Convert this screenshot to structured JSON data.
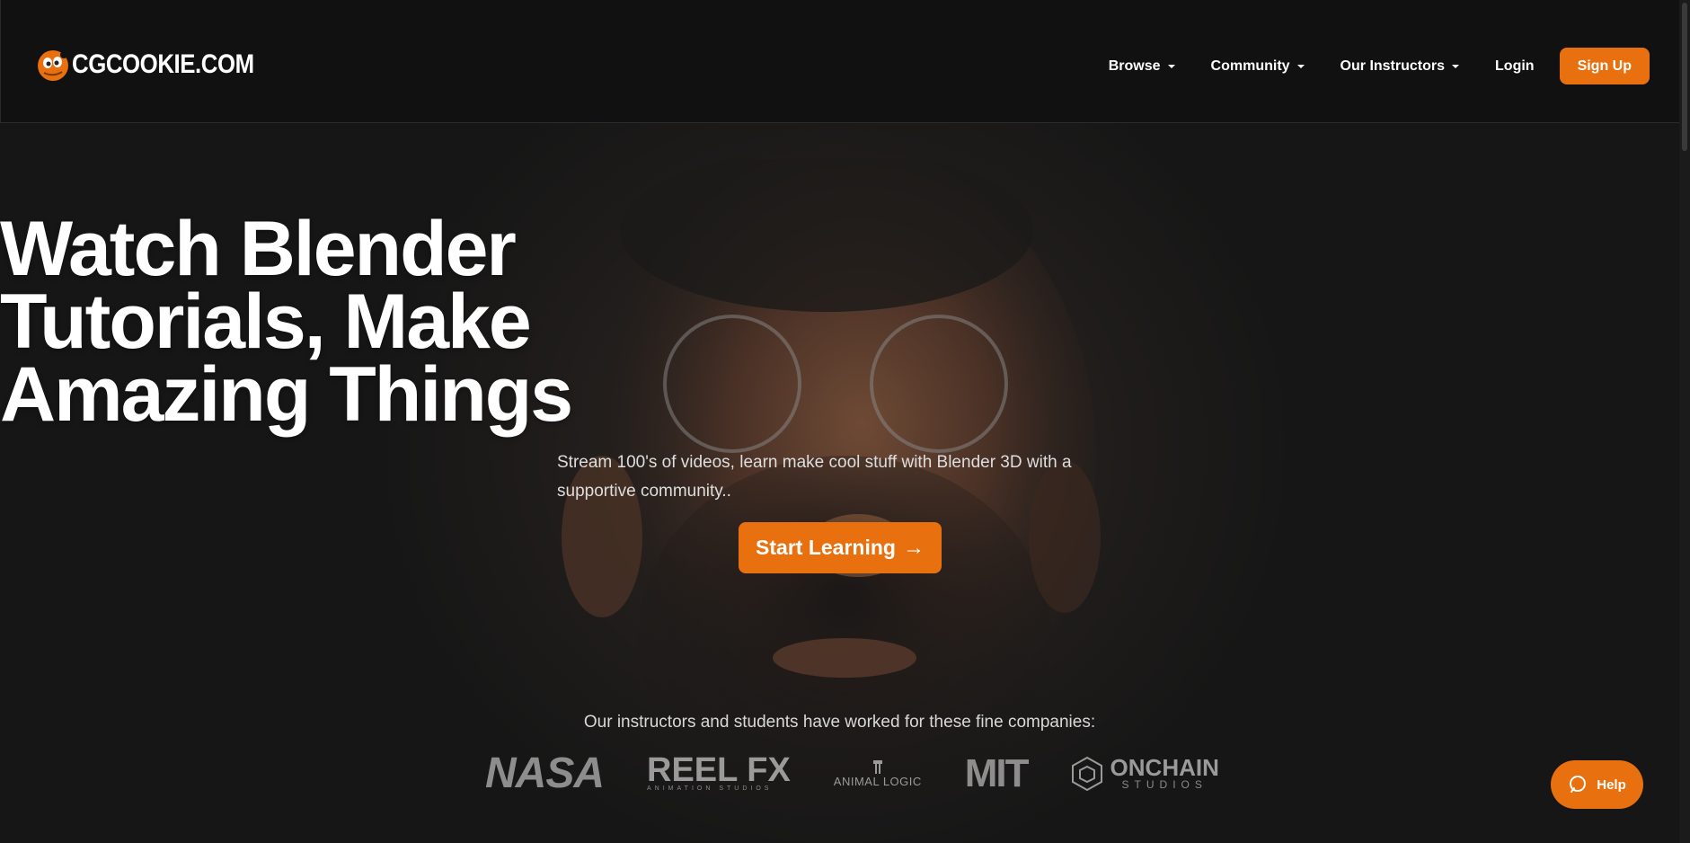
{
  "header": {
    "logo_text": "CGCOOKIE.COM",
    "nav": [
      {
        "label": "Browse",
        "has_dropdown": true
      },
      {
        "label": "Community",
        "has_dropdown": true
      },
      {
        "label": "Our Instructors",
        "has_dropdown": true
      },
      {
        "label": "Login",
        "has_dropdown": false
      }
    ],
    "signup_label": "Sign Up"
  },
  "hero": {
    "headline_line1": "Watch Blender",
    "headline_line2": "Tutorials, Make",
    "headline_line3": "Amazing Things",
    "subtitle_line1": "Stream 100's of videos, learn make cool stuff with Blender 3D with a",
    "subtitle_line2": "supportive community..",
    "cta_label": "Start Learning",
    "cta_arrow": "→"
  },
  "companies": {
    "title": "Our instructors and students have worked for these fine companies:",
    "logos": [
      {
        "name": "NASA",
        "text": "NASA"
      },
      {
        "name": "Reel FX",
        "text": "REEL FX",
        "subtext": "ANIMATION STUDIOS"
      },
      {
        "name": "Animal Logic",
        "text": "ANIMAL LOGIC"
      },
      {
        "name": "MIT",
        "text": "MIT"
      },
      {
        "name": "Onchain Studios",
        "text": "ONCHAIN",
        "subtext": "STUDIOS"
      }
    ]
  },
  "help": {
    "label": "Help"
  },
  "colors": {
    "accent": "#e8700f",
    "background": "#111112"
  }
}
